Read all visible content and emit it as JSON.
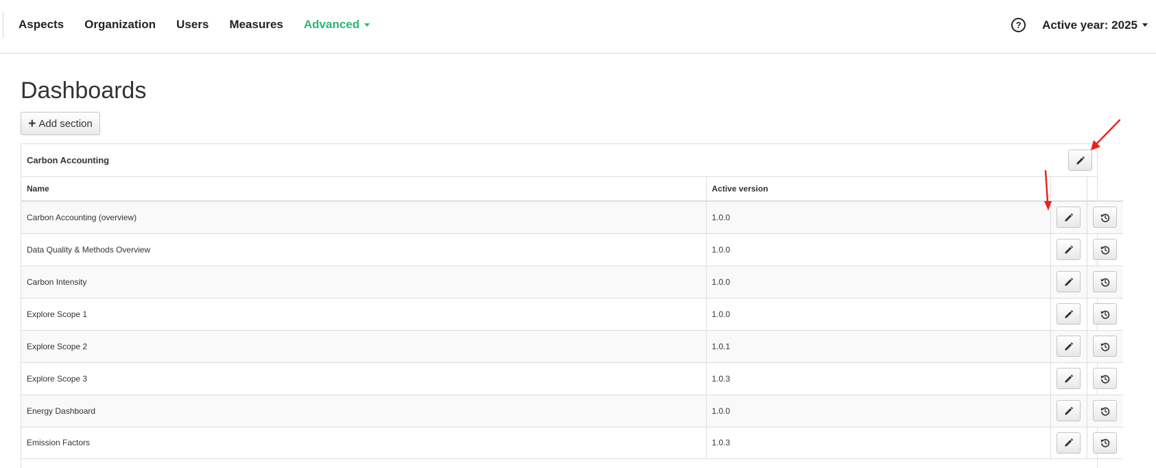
{
  "nav": {
    "items": [
      {
        "label": "Aspects"
      },
      {
        "label": "Organization"
      },
      {
        "label": "Users"
      },
      {
        "label": "Measures"
      },
      {
        "label": "Advanced",
        "active": true,
        "has_dropdown": true
      }
    ],
    "help_icon": "question-circle-icon",
    "help_glyph": "?",
    "active_year_label": "Active year: 2025"
  },
  "page": {
    "title": "Dashboards",
    "add_section_label": "Add section",
    "add_section_glyph": "+"
  },
  "section": {
    "title": "Carbon Accounting",
    "edit_icon": "pencil-icon",
    "columns": {
      "name": "Name",
      "version": "Active version"
    },
    "rows": [
      {
        "name": "Carbon Accounting (overview)",
        "version": "1.0.0"
      },
      {
        "name": "Data Quality & Methods Overview",
        "version": "1.0.0"
      },
      {
        "name": "Carbon Intensity",
        "version": "1.0.0"
      },
      {
        "name": "Explore Scope 1",
        "version": "1.0.0"
      },
      {
        "name": "Explore Scope 2",
        "version": "1.0.1"
      },
      {
        "name": "Explore Scope 3",
        "version": "1.0.3"
      },
      {
        "name": "Energy Dashboard",
        "version": "1.0.0"
      },
      {
        "name": "Emission Factors",
        "version": "1.0.3"
      }
    ],
    "row_edit_icon": "pencil-icon",
    "row_history_icon": "history-icon"
  },
  "colors": {
    "accent": "#2bb673",
    "version_text": "#3a8e1a",
    "annotation_arrow": "#e8241b"
  }
}
